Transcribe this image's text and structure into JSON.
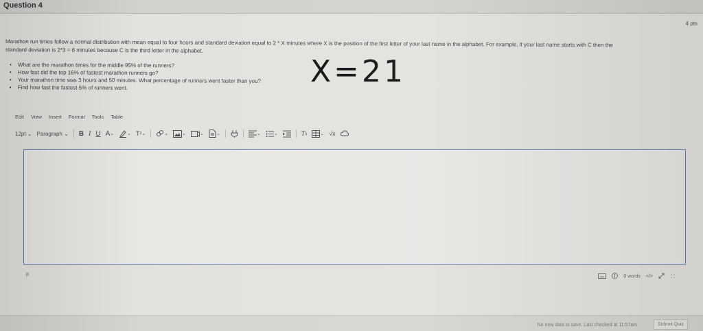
{
  "question": {
    "title": "Question 4",
    "points": "4 pts",
    "prompt_line1": "Marathon run times follow a normal distribution with mean equal to four hours and standard deviation equal to 2 * X minutes where X is the position of the first letter of your last name in the alphabet. For example, if your last name starts with C then the",
    "prompt_line2": "standard deviation is 2*3 = 6 minutes because C is the third letter in the alphabet.",
    "bullets": [
      "What are the marathon times for the middle 95% of the runners?",
      "How fast did the top 16% of fastest marathon runners go?",
      "Your marathon time was 3 hours and 50 minutes. What percentage of runners went faster than you?",
      "Find how fast the fastest 5% of runners went."
    ],
    "handwritten_note": "X=21"
  },
  "editor": {
    "menu": [
      "Edit",
      "View",
      "Insert",
      "Format",
      "Tools",
      "Table"
    ],
    "font_size": "12pt",
    "block_format": "Paragraph",
    "path_label": "p",
    "word_count": "0 words",
    "html_toggle": "</>"
  },
  "footer": {
    "save_status": "No new data to save. Last checked at 11:57am",
    "submit_label": "Submit Quiz"
  },
  "colors": {
    "editor_border": "#5d79b5",
    "background": "#e4e2de"
  }
}
